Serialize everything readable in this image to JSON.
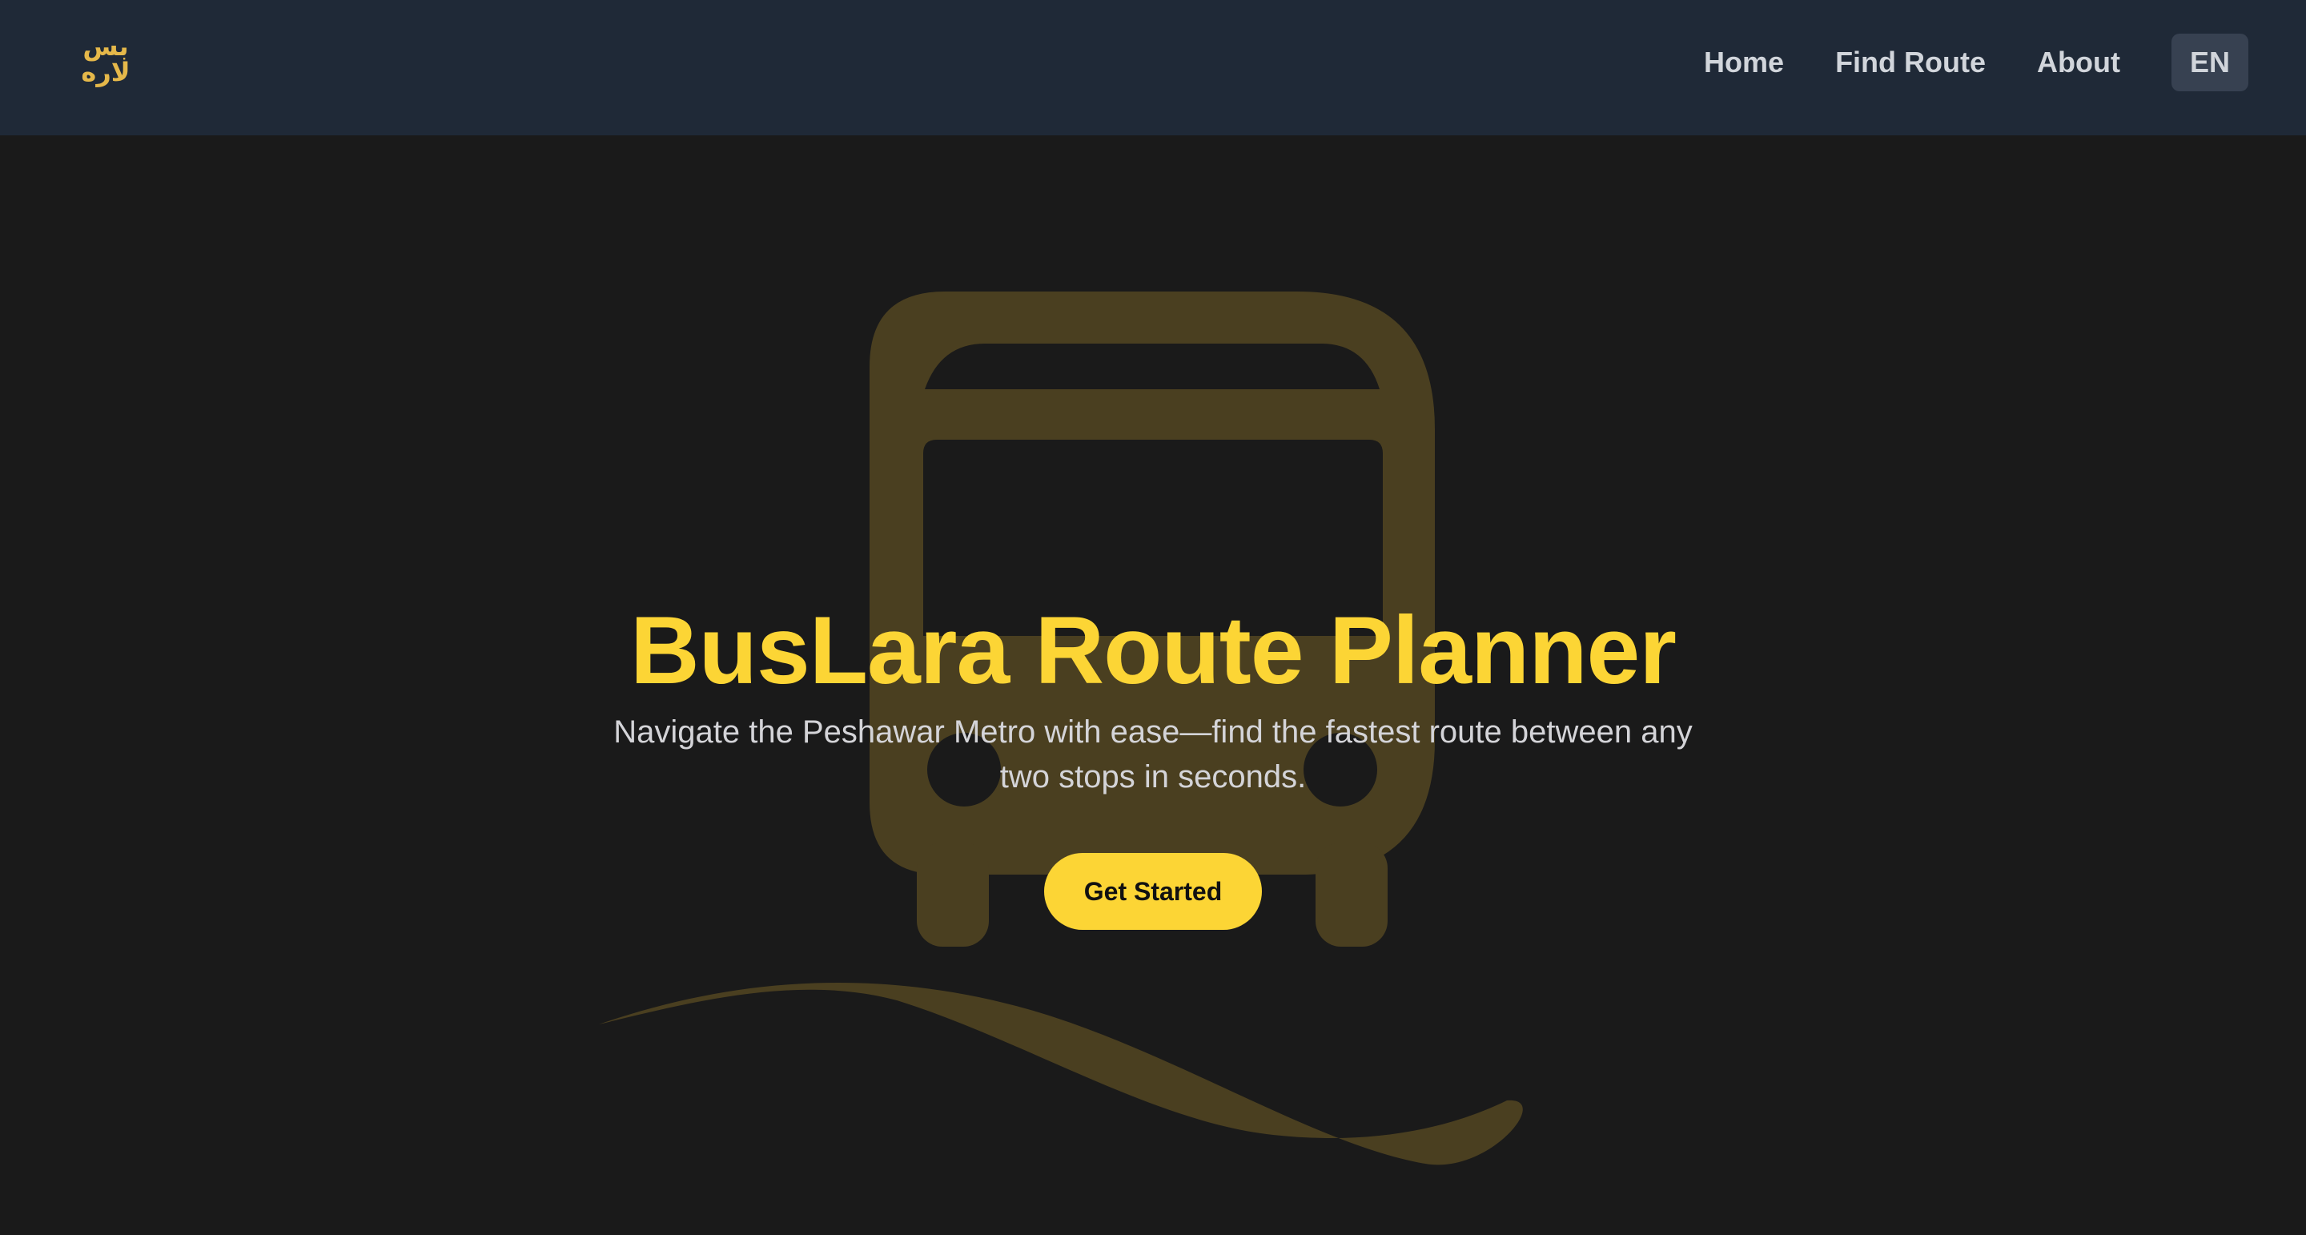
{
  "nav": {
    "logo_line1": "بس",
    "logo_line2": "لاره",
    "links": [
      {
        "label": "Home"
      },
      {
        "label": "Find Route"
      },
      {
        "label": "About"
      }
    ],
    "language_button": "EN"
  },
  "hero": {
    "title": "BusLara Route Planner",
    "subtitle": "Navigate the Peshawar Metro with ease—find the fastest route between any two stops in seconds.",
    "cta_label": "Get Started",
    "background_icon": "bus-icon"
  },
  "colors": {
    "navbar_bg": "#1f2937",
    "page_bg": "#1a1a1a",
    "accent": "#fcd535",
    "logo": "#e5b84a",
    "nav_text": "#d1d5db",
    "lang_btn_bg": "#374151",
    "subtitle_text": "#d4d4d8",
    "graphic": "#4a3f20"
  }
}
